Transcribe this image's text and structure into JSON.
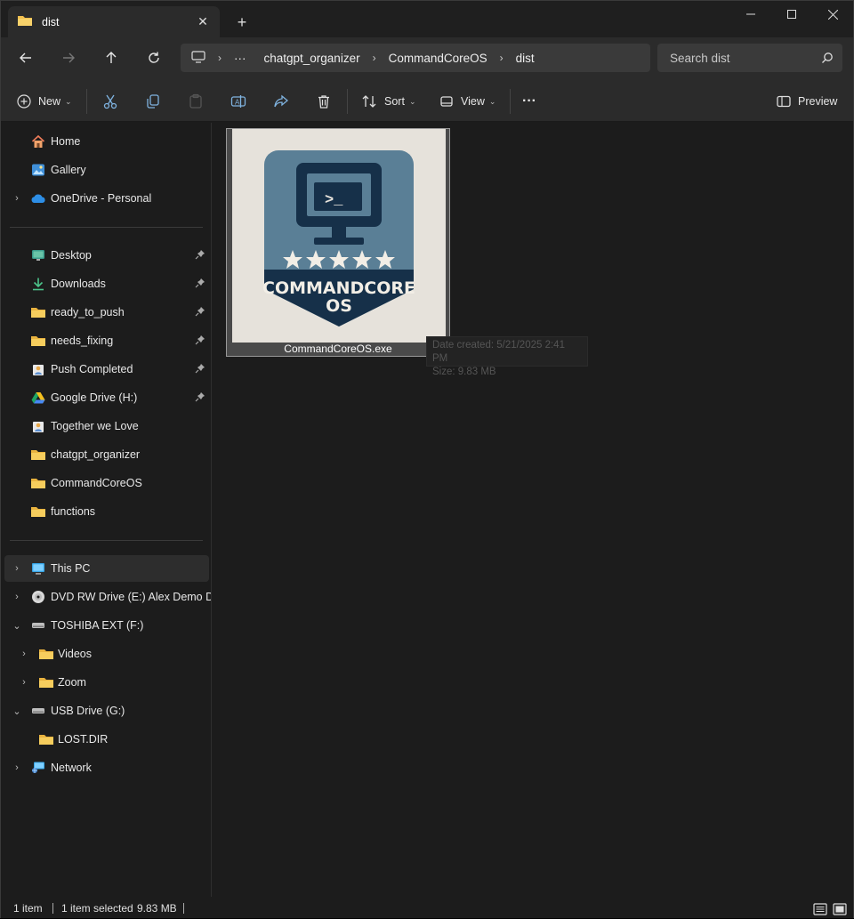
{
  "window": {
    "tab_title": "dist",
    "controls": {
      "minimize": "minimize",
      "maximize": "maximize",
      "close": "close"
    }
  },
  "address": {
    "breadcrumbs": [
      "chatgpt_organizer",
      "CommandCoreOS",
      "dist"
    ],
    "overflow": "···",
    "search_placeholder": "Search dist"
  },
  "toolbar": {
    "new_label": "New",
    "sort_label": "Sort",
    "view_label": "View",
    "more_label": "···",
    "preview_label": "Preview"
  },
  "sidebar": {
    "quick": [
      {
        "label": "Home",
        "icon": "home-icon"
      },
      {
        "label": "Gallery",
        "icon": "gallery-icon"
      },
      {
        "label": "OneDrive - Personal",
        "icon": "cloud-icon"
      }
    ],
    "pinned": [
      {
        "label": "Desktop",
        "icon": "desktop-icon",
        "pinned": true
      },
      {
        "label": "Downloads",
        "icon": "download-icon",
        "pinned": true
      },
      {
        "label": "ready_to_push",
        "icon": "folder-icon",
        "pinned": true
      },
      {
        "label": "needs_fixing",
        "icon": "folder-icon",
        "pinned": true
      },
      {
        "label": "Push Completed",
        "icon": "user-folder-icon",
        "pinned": true
      },
      {
        "label": "Google Drive (H:)",
        "icon": "google-drive-icon",
        "pinned": true
      },
      {
        "label": "Together we Love",
        "icon": "user-folder-icon",
        "pinned": false
      },
      {
        "label": "chatgpt_organizer",
        "icon": "folder-icon",
        "pinned": false
      },
      {
        "label": "CommandCoreOS",
        "icon": "folder-icon",
        "pinned": false
      },
      {
        "label": "functions",
        "icon": "folder-icon",
        "pinned": false
      }
    ],
    "devices": [
      {
        "label": "This PC",
        "icon": "pc-icon"
      },
      {
        "label": "DVD RW Drive (E:) Alex Demo DVD",
        "icon": "dvd-icon"
      },
      {
        "label": "TOSHIBA EXT (F:)",
        "icon": "drive-icon"
      },
      {
        "label": "Videos",
        "icon": "folder-icon"
      },
      {
        "label": "Zoom",
        "icon": "folder-icon"
      },
      {
        "label": "USB Drive (G:)",
        "icon": "drive-icon"
      },
      {
        "label": "LOST.DIR",
        "icon": "folder-icon"
      },
      {
        "label": "Network",
        "icon": "network-icon"
      }
    ]
  },
  "content": {
    "file_name": "CommandCoreOS.exe",
    "thumb_text_1": "COMMANDCORE",
    "thumb_text_2": "OS",
    "thumb_prompt": ">_",
    "tooltip_line1": "Date created: 5/21/2025 2:41 PM",
    "tooltip_line2": "Size: 9.83 MB"
  },
  "status": {
    "count": "1 item",
    "selected": "1 item selected",
    "size": "9.83 MB"
  },
  "colors": {
    "background": "#1c1c1c",
    "bar": "#2b2b2b",
    "folder": "#f3c04f",
    "badge_blue": "#5a7f96",
    "badge_navy": "#163049"
  }
}
